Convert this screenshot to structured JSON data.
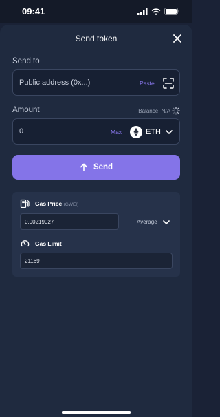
{
  "status": {
    "time": "09:41"
  },
  "header": {
    "title": "Send token"
  },
  "send_to": {
    "label": "Send to",
    "placeholder": "Public address (0x...)",
    "paste_label": "Paste"
  },
  "amount": {
    "label": "Amount",
    "balance": "Balance: N/A",
    "value": "0",
    "max_label": "Max",
    "token": "ETH"
  },
  "send_button": {
    "label": "Send"
  },
  "gas": {
    "price_label": "Gas Price",
    "price_unit": "(GWEI)",
    "price_value": "0,00219027",
    "speed": "Average",
    "limit_label": "Gas Limit",
    "limit_value": "21169"
  },
  "colors": {
    "accent": "#8474e8",
    "background": "#1f2a3f",
    "panel": "#26324a"
  }
}
